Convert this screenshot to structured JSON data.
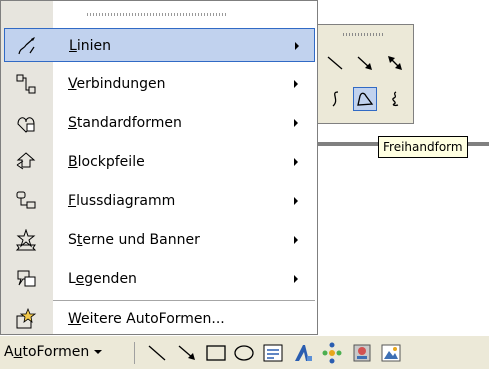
{
  "menu": {
    "items": [
      {
        "label": "Linien",
        "mnemonic": "L",
        "rest": "inien",
        "submenu": true,
        "icon": "lines-category-icon",
        "highlighted": true
      },
      {
        "label": "Verbindungen",
        "mnemonic": "V",
        "rest": "erbindungen",
        "submenu": true,
        "icon": "connectors-icon"
      },
      {
        "label": "Standardformen",
        "mnemonic": "S",
        "rest": "tandardformen",
        "submenu": true,
        "icon": "basic-shapes-icon"
      },
      {
        "label": "Blockpfeile",
        "mnemonic": "B",
        "rest": "lockpfeile",
        "submenu": true,
        "icon": "block-arrows-icon"
      },
      {
        "label": "Flussdiagramm",
        "mnemonic": "F",
        "rest": "lussdiagramm",
        "submenu": true,
        "icon": "flowchart-icon"
      },
      {
        "label": "Sterne und Banner",
        "pre": "S",
        "mnemonic": "t",
        "rest": "erne und Banner",
        "submenu": true,
        "icon": "stars-banners-icon"
      },
      {
        "label": "Legenden",
        "pre": "L",
        "mnemonic": "e",
        "rest": "genden",
        "submenu": true,
        "icon": "callouts-icon"
      },
      {
        "label": "Weitere AutoFormen...",
        "mnemonic": "W",
        "rest": "eitere AutoFormen...",
        "submenu": false,
        "icon": "more-autoshapes-icon"
      }
    ]
  },
  "submenu": {
    "tools": [
      "line-tool",
      "arrow-tool",
      "double-arrow-tool",
      "curve-tool",
      "freeform-tool",
      "scribble-tool"
    ],
    "active_tool": "freeform-tool"
  },
  "tooltip": {
    "text": "Freihandform"
  },
  "toolbar": {
    "autoformen_label": "AutoFormen",
    "autoformen_pre": "A",
    "autoformen_mnemonic": "u",
    "autoformen_rest": "toFormen",
    "tools": [
      "line-icon",
      "arrow-icon",
      "rectangle-icon",
      "oval-icon",
      "textbox-icon",
      "wordart-icon",
      "diagram-icon",
      "clipart-icon",
      "picture-icon"
    ]
  }
}
